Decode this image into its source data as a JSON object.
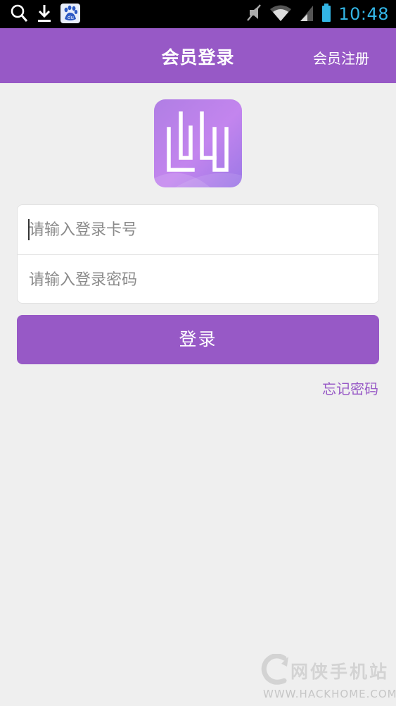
{
  "status_bar": {
    "time": "10:48",
    "icons": [
      "search-icon",
      "download-icon",
      "baidu-icon",
      "mute-icon",
      "wifi-icon",
      "signal-icon",
      "battery-icon"
    ],
    "time_color": "#33b5e5"
  },
  "header": {
    "title": "会员登录",
    "action_label": "会员注册",
    "bg_color": "#9759c6"
  },
  "logo": {
    "icon": "open-book-icon"
  },
  "form": {
    "card_number": {
      "value": "",
      "placeholder": "请输入登录卡号"
    },
    "password": {
      "value": "",
      "placeholder": "请输入登录密码"
    }
  },
  "login_button": {
    "label": "登录"
  },
  "forgot_password": {
    "label": "忘记密码"
  },
  "watermark": {
    "name": "网侠手机站",
    "url": "WWW.HACKHOME.COM",
    "icon": "hackhome-logo-icon"
  }
}
